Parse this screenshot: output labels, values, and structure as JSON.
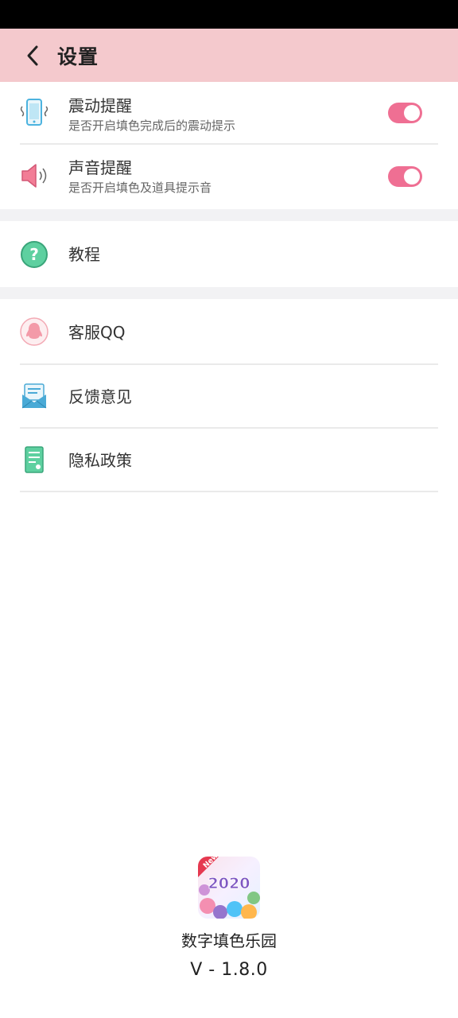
{
  "header": {
    "title": "设置",
    "back_icon": "chevron-left-icon"
  },
  "settings": {
    "vibration": {
      "title": "震动提醒",
      "subtitle": "是否开启填色完成后的震动提示",
      "icon": "phone-vibrate-icon",
      "enabled": true
    },
    "sound": {
      "title": "声音提醒",
      "subtitle": "是否开启填色及道具提示音",
      "icon": "speaker-icon",
      "enabled": true
    },
    "tutorial": {
      "title": "教程",
      "icon": "help-circle-icon"
    },
    "support_qq": {
      "title": "客服QQ",
      "icon": "qq-penguin-icon"
    },
    "feedback": {
      "title": "反馈意见",
      "icon": "envelope-message-icon"
    },
    "privacy": {
      "title": "隐私政策",
      "icon": "document-icon"
    }
  },
  "footer": {
    "app_name": "数字填色乐园",
    "version": "V - 1.8.0",
    "logo_badge": "New",
    "logo_year": "2020"
  },
  "colors": {
    "header_bg": "#f4c9cd",
    "toggle_on": "#ef6f93",
    "divider": "#eaeaea",
    "section_gap": "#f2f2f4"
  }
}
